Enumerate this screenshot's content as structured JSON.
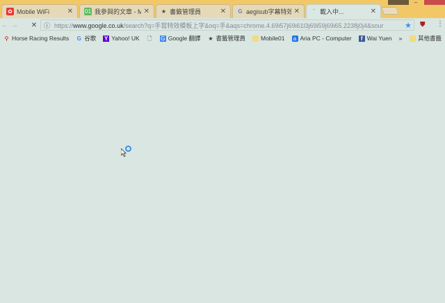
{
  "tabs": [
    {
      "label": "Mobile WiFi",
      "icon": "huawei-icon"
    },
    {
      "label": "我參與的文章 - M",
      "icon": "mobile01-icon"
    },
    {
      "label": "書籤管理員",
      "icon": "star-icon"
    },
    {
      "label": "aegisub字幕特效",
      "icon": "google-icon"
    },
    {
      "label": "載入中...",
      "icon": "loading-icon",
      "active": true
    }
  ],
  "toolbar": {
    "url_scheme": "https://",
    "url_host": "www.google.co.uk",
    "url_rest": "/search?q=手寫特效模板上字&oq=手&aqs=chrome.4.69i57j69i61l3j69i59j69i65.2238j0j4&sour"
  },
  "bookmarks": [
    {
      "label": "Horse Racing Results",
      "icon": "pin-icon"
    },
    {
      "label": "谷歌",
      "icon": "google-icon"
    },
    {
      "label": "Yahoo! UK",
      "icon": "yahoo-icon"
    },
    {
      "label": "",
      "icon": "page-icon"
    },
    {
      "label": "Google 翻譯",
      "icon": "translate-icon"
    },
    {
      "label": "書籤管理員",
      "icon": "star-icon"
    },
    {
      "label": "Mobile01",
      "icon": "folder-icon"
    },
    {
      "label": "Aria PC - Computer",
      "icon": "aria-icon"
    },
    {
      "label": "Wai Yuen",
      "icon": "facebook-icon"
    }
  ],
  "more_label": "»",
  "other_bookmarks": "其他書籤",
  "colors": {
    "frame": "#f2c866",
    "page": "#d9e6e1",
    "accent": "#3c8fe8"
  }
}
